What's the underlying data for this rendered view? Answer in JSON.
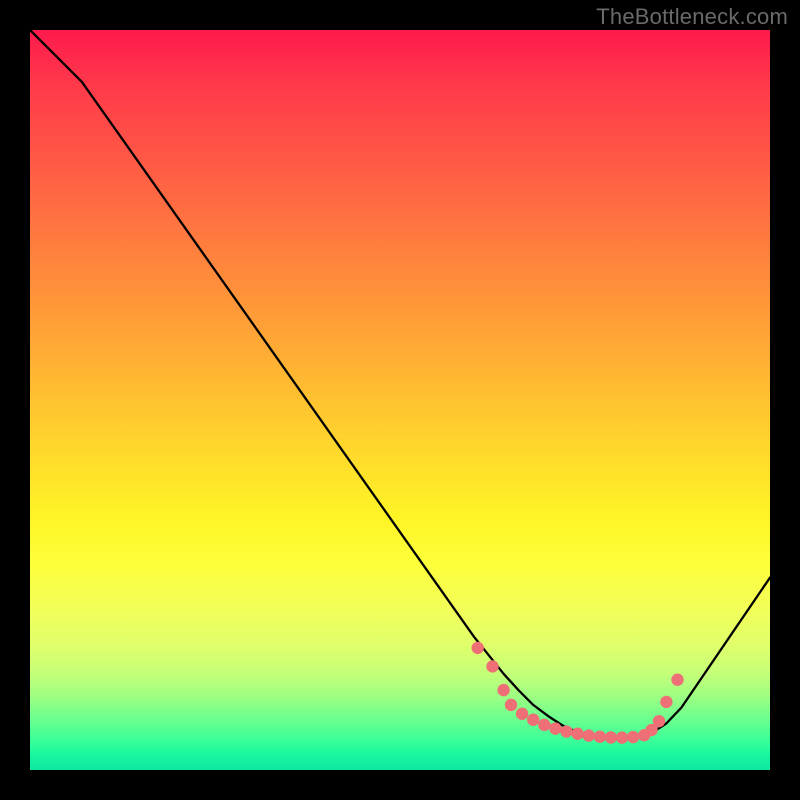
{
  "watermark": "TheBottleneck.com",
  "chart_data": {
    "type": "line",
    "title": "",
    "xlabel": "",
    "ylabel": "",
    "xlim": [
      0,
      100
    ],
    "ylim": [
      0,
      100
    ],
    "series": [
      {
        "name": "curve",
        "x": [
          0,
          4,
          7,
          60,
          62,
          64,
          66,
          68,
          70,
          72,
          74,
          76,
          78,
          80,
          82,
          84,
          86,
          88,
          100
        ],
        "y": [
          100,
          96,
          93,
          18,
          15.5,
          13,
          10.8,
          8.8,
          7.3,
          6,
          5.1,
          4.5,
          4.2,
          4.1,
          4.4,
          5,
          6.3,
          8.4,
          26
        ]
      }
    ],
    "markers": {
      "name": "dots",
      "color": "#ef6f77",
      "x": [
        60.5,
        62.5,
        64,
        65,
        66.5,
        68,
        69.5,
        71,
        72.5,
        74,
        75.5,
        77,
        78.5,
        80,
        81.5,
        83,
        84,
        85,
        86,
        87.5
      ],
      "y": [
        16.5,
        14,
        10.8,
        8.8,
        7.6,
        6.8,
        6.1,
        5.6,
        5.2,
        4.9,
        4.65,
        4.5,
        4.4,
        4.38,
        4.45,
        4.7,
        5.4,
        6.6,
        9.2,
        12.2
      ]
    }
  }
}
